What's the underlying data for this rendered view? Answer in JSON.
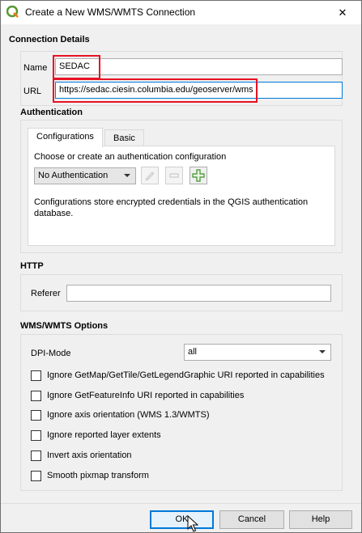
{
  "window": {
    "title": "Create a New WMS/WMTS Connection",
    "close_glyph": "✕"
  },
  "connection": {
    "section_label": "Connection Details",
    "name_label": "Name",
    "name_value": "SEDAC",
    "url_label": "URL",
    "url_value": "https://sedac.ciesin.columbia.edu/geoserver/wms"
  },
  "auth": {
    "section_label": "Authentication",
    "tabs": [
      {
        "label": "Configurations",
        "active": true
      },
      {
        "label": "Basic",
        "active": false
      }
    ],
    "choose_text": "Choose or create an authentication configuration",
    "combo_value": "No Authentication",
    "info_text": "Configurations store encrypted credentials in the QGIS authentication database."
  },
  "http": {
    "section_label": "HTTP",
    "referer_label": "Referer",
    "referer_value": ""
  },
  "wms": {
    "section_label": "WMS/WMTS Options",
    "dpi_label": "DPI-Mode",
    "dpi_value": "all",
    "options": [
      {
        "label": "Ignore GetMap/GetTile/GetLegendGraphic URI reported in capabilities",
        "checked": false
      },
      {
        "label": "Ignore GetFeatureInfo URI reported in capabilities",
        "checked": false
      },
      {
        "label": "Ignore axis orientation (WMS 1.3/WMTS)",
        "checked": false
      },
      {
        "label": "Ignore reported layer extents",
        "checked": false
      },
      {
        "label": "Invert axis orientation",
        "checked": false
      },
      {
        "label": "Smooth pixmap transform",
        "checked": false
      }
    ]
  },
  "buttons": {
    "ok": "OK",
    "cancel": "Cancel",
    "help": "Help"
  },
  "colors": {
    "highlight_red": "#e81123",
    "focus_blue": "#0078d7",
    "qgis_green": "#589632"
  },
  "icons": [
    "qgis-logo-icon",
    "close-icon",
    "edit-pencil-icon",
    "remove-icon",
    "add-plus-icon",
    "chevron-down-icon",
    "mouse-cursor-icon"
  ]
}
